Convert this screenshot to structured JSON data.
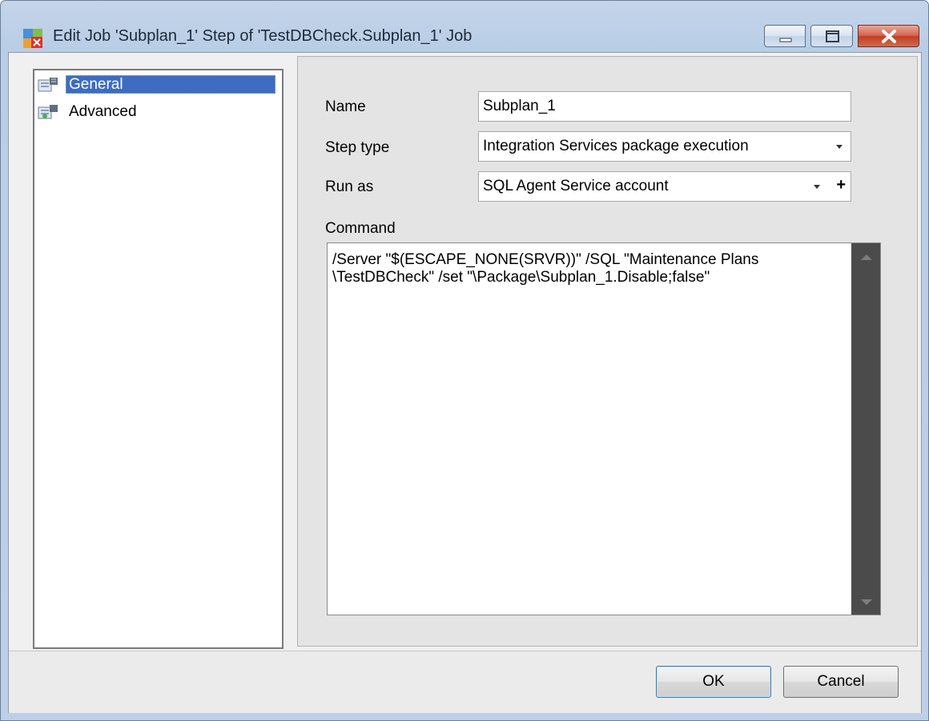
{
  "window": {
    "title": "Edit Job 'Subplan_1' Step of 'TestDBCheck.Subplan_1' Job"
  },
  "nav": {
    "items": [
      {
        "label": "General",
        "icon": "job-step-icon",
        "selected": true
      },
      {
        "label": "Advanced",
        "icon": "job-step-icon",
        "selected": false
      }
    ]
  },
  "form": {
    "name_label": "Name",
    "name_value": "Subplan_1",
    "step_type_label": "Step type",
    "step_type_value": "Integration Services package execution",
    "run_as_label": "Run as",
    "run_as_value": "SQL Agent Service account",
    "run_as_add": "+",
    "command_label": "Command",
    "command_value": "/Server \"$(ESCAPE_NONE(SRVR))\" /SQL \"Maintenance Plans\n\\TestDBCheck\" /set \"\\Package\\Subplan_1.Disable;false\""
  },
  "buttons": {
    "ok_label": "OK",
    "cancel_label": "Cancel"
  },
  "colors": {
    "selection": "#3d6cc0",
    "title_bar": "#c4d5ea",
    "close_button": "#c13e23"
  }
}
